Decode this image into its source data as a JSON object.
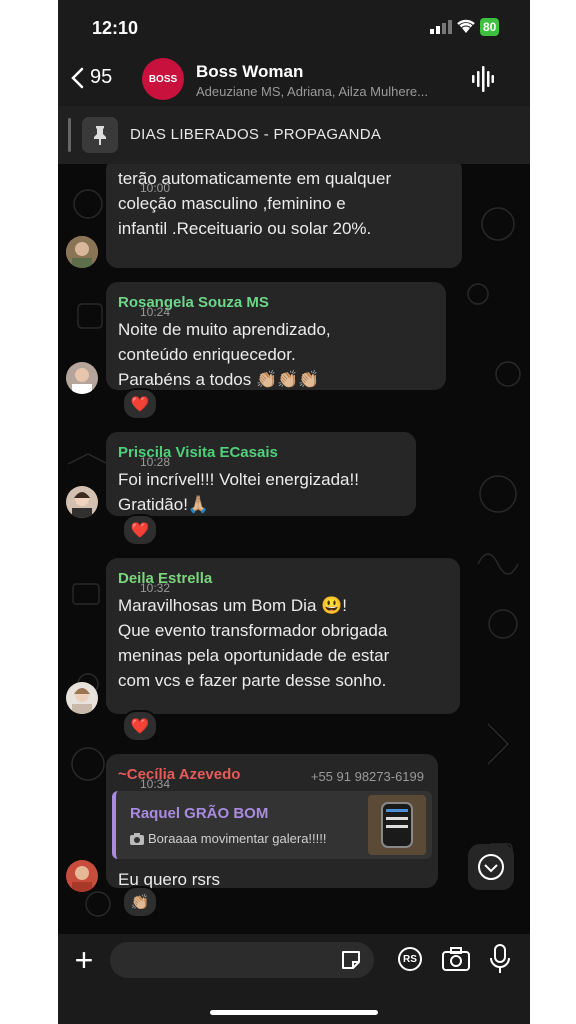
{
  "status": {
    "time": "12:10",
    "battery": "80"
  },
  "header": {
    "back_count": "95",
    "group_avatar": "BOSS",
    "title": "Boss Woman",
    "subtitle": "Adeuziane MS, Adriana, Ailza Mulhere..."
  },
  "pinned": {
    "text": "DIAS LIBERADOS - PROPAGANDA"
  },
  "messages": [
    {
      "name": "",
      "text": "terão automaticamente em qualquer\ncoleção masculino ,feminino e\ninfantil .Receituario ou solar 20%.",
      "time": "10:00"
    },
    {
      "name": "Rosangela  Souza MS",
      "text": "Noite de muito aprendizado,\nconteúdo enriquecedor.\nParabéns a todos 👏🏼👏🏼👏🏼",
      "time": "10:24",
      "reaction": "❤️"
    },
    {
      "name": "Priscila Visita ECasais",
      "text": "Foi incrível!!! Voltei energizada!!\nGratidão!🙏🏼",
      "time": "10:28",
      "reaction": "❤️"
    },
    {
      "name": "Deila Estrella",
      "text": "Maravilhosas um Bom Dia 😃!\nQue evento transformador obrigada\nmeninas pela oportunidade de estar\ncom vcs e fazer parte desse sonho.",
      "time": "10:32",
      "reaction": "❤️"
    },
    {
      "name": "~Cecília Azevedo",
      "phone": "+55 91 98273-6199",
      "reply_name": "Raquel GRÃO BOM",
      "reply_text": "Boraaaa movimentar galera!!!!!",
      "text": "Eu quero rsrs",
      "time": "10:34",
      "reaction": "👏🏼"
    }
  ],
  "input": {
    "rs_label": "RS"
  },
  "colors": {
    "rosangela": "#6cd68a",
    "priscila": "#4fd17a",
    "deila": "#7ad67a",
    "cecilia": "#e85a5a",
    "reply": "#a98be0"
  }
}
